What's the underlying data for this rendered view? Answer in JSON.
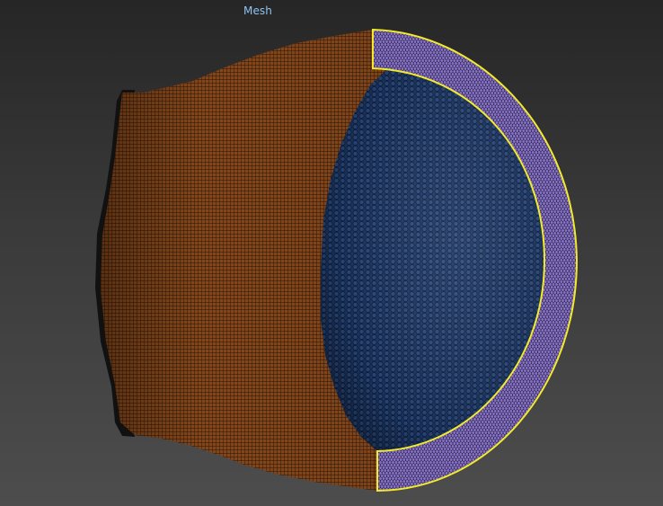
{
  "viewport": {
    "title": "Mesh",
    "title_color": "#8fc4f0",
    "background_top": "#262626",
    "background_bottom": "#4d4d4d"
  },
  "mesh": {
    "cylinder_color": "#8a4a1c",
    "cylinder_grid_color": "#2a1406",
    "dome_color": "#1d3765",
    "dome_cell_color": "#0c1a33",
    "cut_face_color": "#8773c4",
    "cut_face_cell_color": "#2e2450",
    "selection_outline_color": "#f2ea2a"
  }
}
